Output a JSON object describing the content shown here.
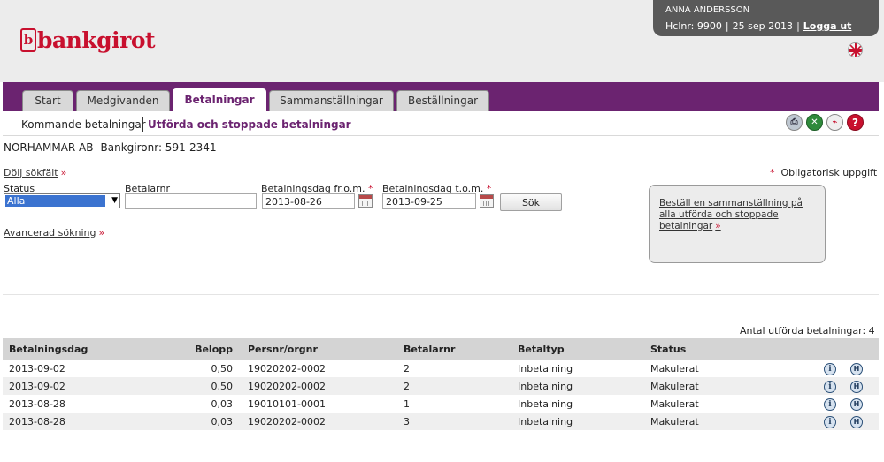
{
  "brand": {
    "logo_mark": "b",
    "logo_text": "bankgirot",
    "color": "#c8102e"
  },
  "user": {
    "name": "ANNA ANDERSSON",
    "customer_number": "Hclnr: 9900",
    "date": "25 sep 2013",
    "logout_label": "Logga ut"
  },
  "flag_icon": "uk-flag-icon",
  "nav": {
    "tabs": [
      {
        "label": "Start",
        "active": false
      },
      {
        "label": "Medgivanden",
        "active": false
      },
      {
        "label": "Betalningar",
        "active": true
      },
      {
        "label": "Sammanställningar",
        "active": false
      },
      {
        "label": "Beställningar",
        "active": false
      }
    ],
    "color": "#6b2370"
  },
  "subnav": {
    "items": [
      {
        "label": "Kommande betalningar",
        "active": false
      },
      {
        "label": "Utförda och stoppade betalningar",
        "active": true
      }
    ],
    "tools": [
      "print-icon",
      "excel-icon",
      "pdf-icon",
      "help-icon"
    ]
  },
  "company": {
    "name": "NORHAMMAR AB",
    "bankgiro": "Bankgironr: 591-2341"
  },
  "search": {
    "toggle_label": "Dölj sökfält",
    "required_note": "Obligatorisk uppgift",
    "required_marker": "*",
    "status_label": "Status",
    "status_value": "Alla",
    "payer_label": "Betalarnr",
    "payer_value": "",
    "from_label": "Betalningsdag fr.o.m.",
    "from_value": "2013-08-26",
    "to_label": "Betalningsdag t.o.m.",
    "to_value": "2013-09-25",
    "search_button": "Sök",
    "advanced_label": "Avancerad sökning",
    "link_arrow": "»"
  },
  "order_box": {
    "link_text": "Beställ en sammanställning på alla utförda och stoppade betalningar"
  },
  "results": {
    "count_text": "Antal utförda betalningar:  4",
    "columns": [
      "Betalningsdag",
      "Belopp",
      "Persnr/orgnr",
      "Betalarnr",
      "Betaltyp",
      "Status"
    ],
    "rows": [
      {
        "date": "2013-09-02",
        "amount": "0,50",
        "id": "19020202-0002",
        "payer": "2",
        "type": "Inbetalning",
        "status": "Makulerat"
      },
      {
        "date": "2013-09-02",
        "amount": "0,50",
        "id": "19020202-0002",
        "payer": "2",
        "type": "Inbetalning",
        "status": "Makulerat"
      },
      {
        "date": "2013-08-28",
        "amount": "0,03",
        "id": "19010101-0001",
        "payer": "1",
        "type": "Inbetalning",
        "status": "Makulerat"
      },
      {
        "date": "2013-08-28",
        "amount": "0,03",
        "id": "19020202-0002",
        "payer": "3",
        "type": "Inbetalning",
        "status": "Makulerat"
      }
    ],
    "row_icons": [
      "info-icon",
      "history-icon"
    ]
  }
}
